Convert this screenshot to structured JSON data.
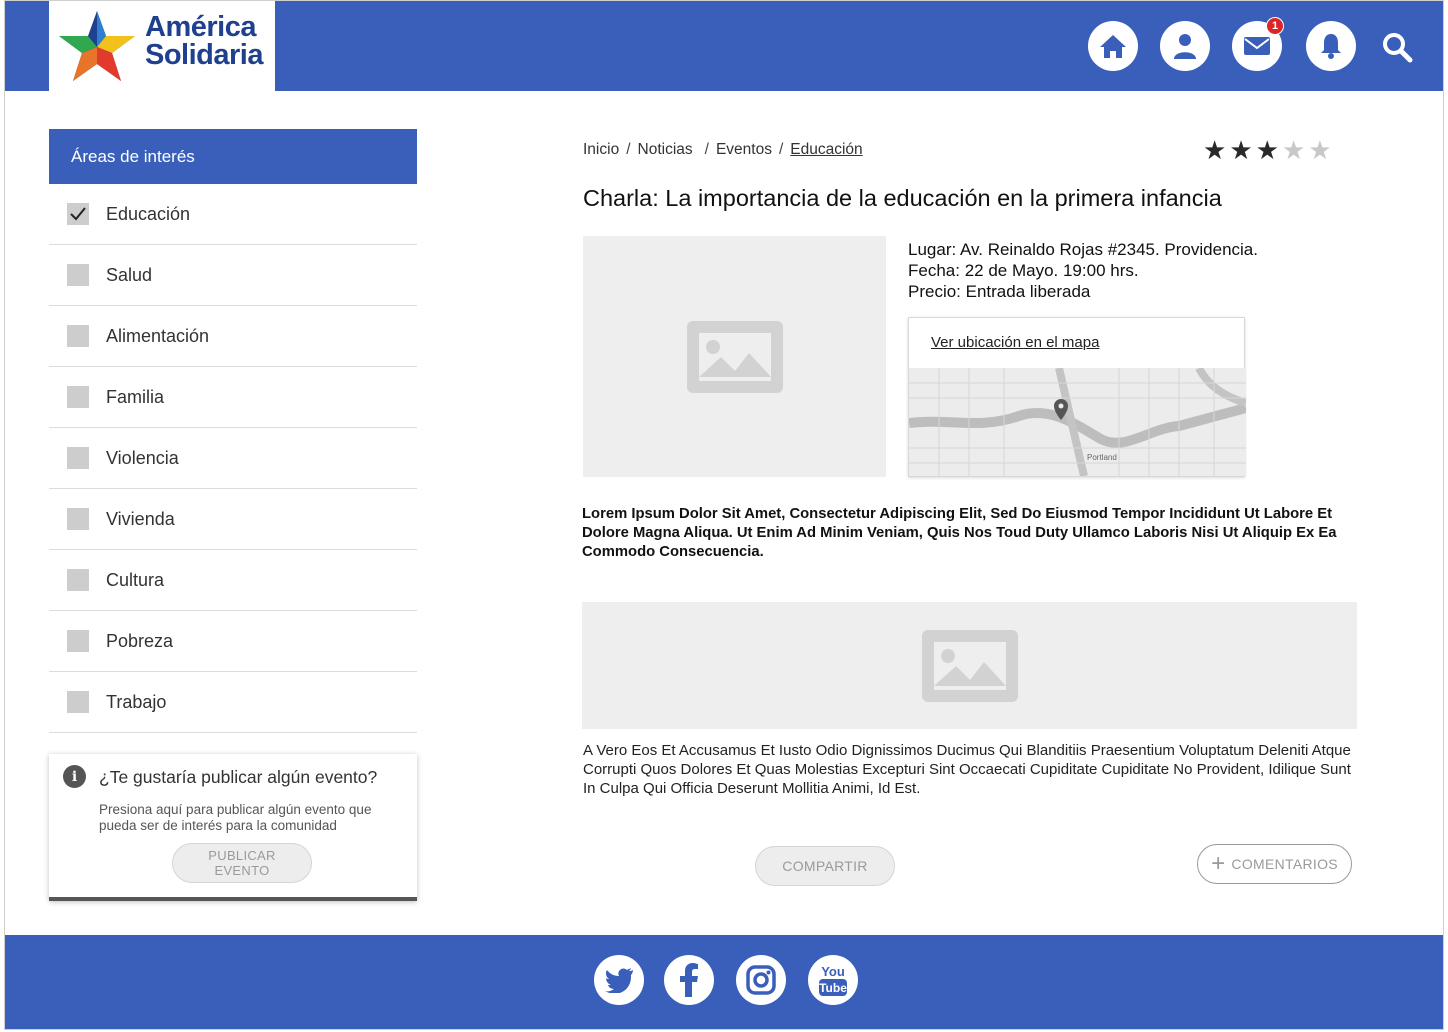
{
  "brand": {
    "line1": "América",
    "line2": "Solidaria"
  },
  "header": {
    "icons": [
      "home-icon",
      "user-icon",
      "mail-icon",
      "bell-icon",
      "search-icon"
    ],
    "mail_badge": "1"
  },
  "sidebar": {
    "heading": "Áreas de interés",
    "items": [
      {
        "label": "Educación",
        "checked": true
      },
      {
        "label": "Salud",
        "checked": false
      },
      {
        "label": "Alimentación",
        "checked": false
      },
      {
        "label": "Familia",
        "checked": false
      },
      {
        "label": "Violencia",
        "checked": false
      },
      {
        "label": "Vivienda",
        "checked": false
      },
      {
        "label": "Cultura",
        "checked": false
      },
      {
        "label": "Pobreza",
        "checked": false
      },
      {
        "label": "Trabajo",
        "checked": false
      }
    ]
  },
  "publish": {
    "title": "¿Te gustaría publicar algún evento?",
    "description": "Presiona  aquí para publicar algún evento que pueda ser de interés para la comunidad",
    "button_line1": "PUBLICAR",
    "button_line2": "EVENTO"
  },
  "breadcrumb": {
    "items": [
      "Inicio",
      "Noticias",
      "Eventos",
      "Educación"
    ]
  },
  "rating": {
    "value": 3,
    "max": 5
  },
  "article": {
    "title": "Charla: La importancia de la educación en la primera infancia",
    "location": "Lugar: Av. Reinaldo Rojas #2345. Providencia.",
    "date": "Fecha: 22 de Mayo. 19:00 hrs.",
    "price": "Precio: Entrada liberada",
    "map_link": "Ver ubicación en el mapa",
    "map_city": "Portland",
    "paragraph1": "Lorem Ipsum Dolor Sit Amet, Consectetur Adipiscing Elit, Sed Do Eiusmod Tempor Incididunt Ut Labore Et Dolore Magna Aliqua. Ut Enim Ad Minim Veniam, Quis Nos Toud Duty Ullamco Laboris Nisi Ut Aliquip Ex Ea Commodo Consecuencia.",
    "paragraph2": "A Vero Eos Et Accusamus Et Iusto Odio Dignissimos Ducimus Qui Blanditiis Praesentium Voluptatum Deleniti Atque Corrupti Quos Dolores Et Quas Molestias Excepturi Sint Occaecati Cupiditate Cupiditate No Provident, Idilique Sunt In Culpa Qui Officia Deserunt Mollitia Animi, Id Est."
  },
  "actions": {
    "share": "COMPARTIR",
    "comments": "COMENTARIOS"
  },
  "footer": {
    "social": [
      "twitter-icon",
      "facebook-icon",
      "instagram-icon",
      "youtube-icon"
    ],
    "youtube_you": "You",
    "youtube_tube": "Tube"
  },
  "colors": {
    "primary": "#3a5fbb",
    "badge": "#d9262b",
    "placeholder": "#eeeeee"
  }
}
